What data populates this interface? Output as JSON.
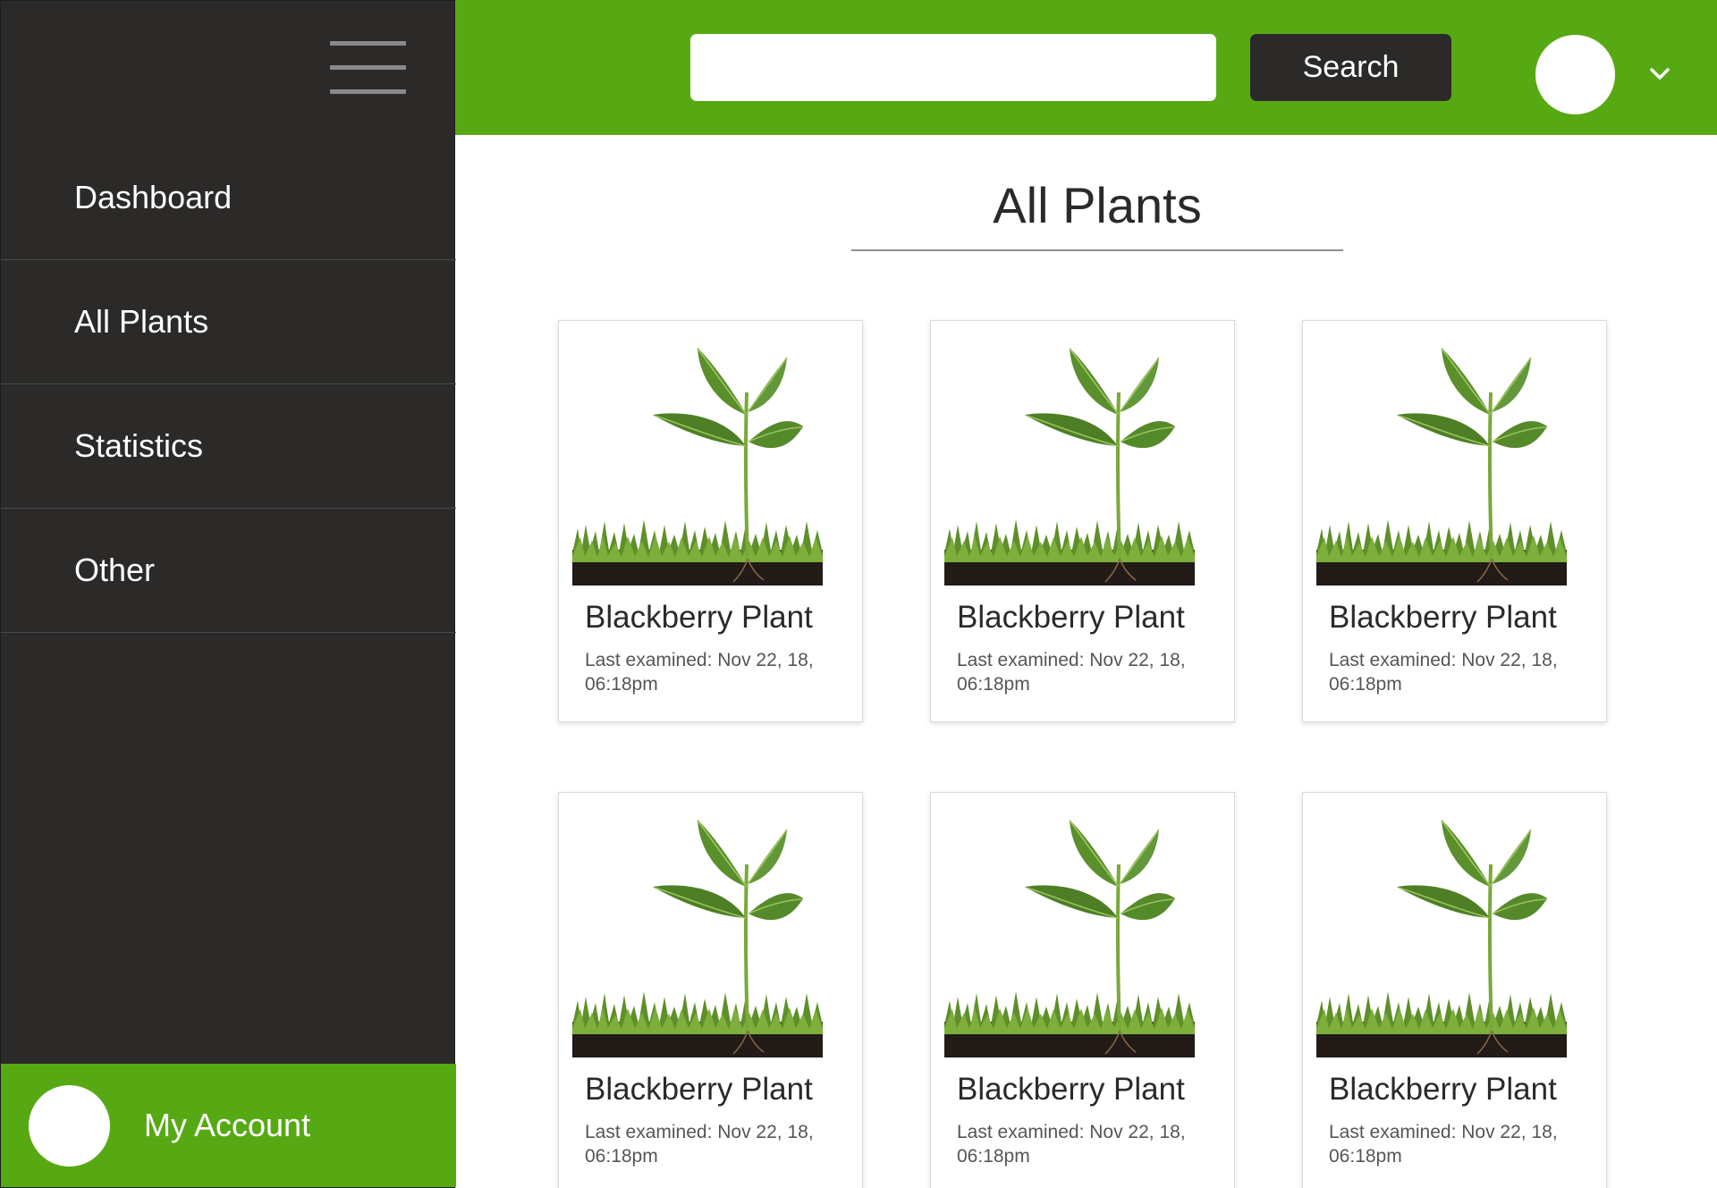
{
  "sidebar": {
    "menu_icon": "hamburger-icon",
    "items": [
      {
        "label": "Dashboard"
      },
      {
        "label": "All Plants"
      },
      {
        "label": "Statistics"
      },
      {
        "label": "Other"
      }
    ],
    "account_label": "My Account"
  },
  "header": {
    "search_value": "",
    "search_button": "Search",
    "dropdown_icon": "chevron-down-icon"
  },
  "main": {
    "title": "All Plants",
    "cards": [
      {
        "title": "Blackberry Plant",
        "meta": "Last examined: Nov 22, 18, 06:18pm"
      },
      {
        "title": "Blackberry Plant",
        "meta": "Last examined: Nov 22, 18, 06:18pm"
      },
      {
        "title": "Blackberry Plant",
        "meta": "Last examined: Nov 22, 18, 06:18pm"
      },
      {
        "title": "Blackberry Plant",
        "meta": "Last examined: Nov 22, 18, 06:18pm"
      },
      {
        "title": "Blackberry Plant",
        "meta": "Last examined: Nov 22, 18, 06:18pm"
      },
      {
        "title": "Blackberry Plant",
        "meta": "Last examined: Nov 22, 18, 06:18pm"
      }
    ]
  },
  "colors": {
    "brand_green": "#57a914",
    "sidebar_bg": "#2b2a29"
  }
}
